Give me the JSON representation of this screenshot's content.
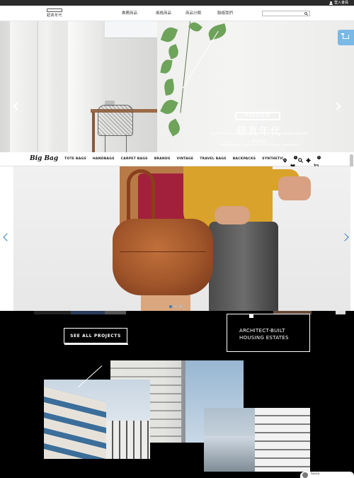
{
  "topbar": {
    "login_label": "登入會員"
  },
  "header1": {
    "logo_plate": "",
    "logo_text": "鈕真年代",
    "nav": [
      "推薦商品",
      "風格商品",
      "商品分類",
      "聯絡我們"
    ],
    "search_placeholder": ""
  },
  "hero1": {
    "badge": "VINTAGE",
    "brand_cn": "鈕真年代",
    "brand_sub": "— 中古軍品 —",
    "lorem_line1": "Lorem ipsum dolor sit amet, consectetur adipiscing elit",
    "lorem_line2": "sed aliquam, purus sit amet luctus venenatis"
  },
  "header2": {
    "logo": "Big Bag",
    "nav": [
      "TOTE BAGS",
      "HANDBAGS",
      "CARPET BAGS",
      "BRANDS",
      "VINTAGE",
      "TRAVEL BAGS",
      "BACKPACKS",
      "SYNTHETIC"
    ],
    "wishlist_count": "1",
    "cart_count": "0"
  },
  "dark_section": {
    "see_all": "SEE ALL PROJECTS",
    "architect_line1": "ARCHITECT-BUILT",
    "architect_line2": "HOUSING ESTATES"
  },
  "chat": {
    "name": "Savia"
  },
  "colors": {
    "accent_blue": "#3a7bbf",
    "cart_tab": "#7ab8e6",
    "leaf_green": "#6ea35a",
    "bag_brown": "#a0552a",
    "sweater_mustard": "#d9a22a"
  }
}
